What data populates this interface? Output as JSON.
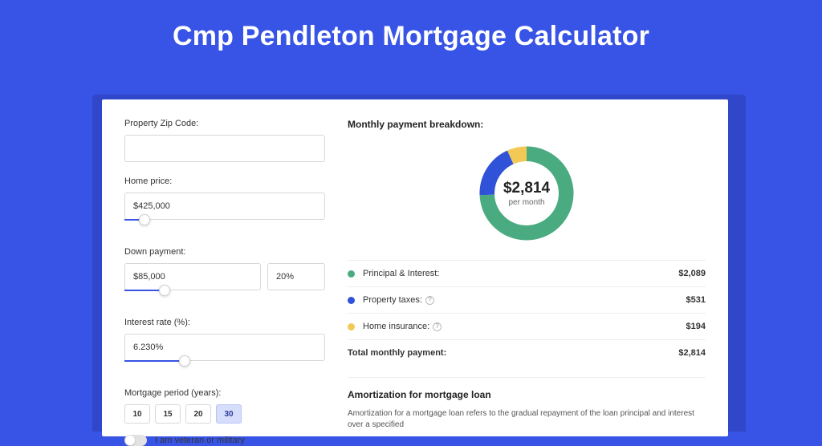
{
  "title": "Cmp Pendleton Mortgage Calculator",
  "form": {
    "zip": {
      "label": "Property Zip Code:",
      "value": ""
    },
    "homePrice": {
      "label": "Home price:",
      "value": "$425,000",
      "sliderPct": 10
    },
    "downPayment": {
      "label": "Down payment:",
      "value": "$85,000",
      "pct": "20%",
      "sliderPct": 20
    },
    "interestRate": {
      "label": "Interest rate (%):",
      "value": "6.230%",
      "sliderPct": 30
    },
    "period": {
      "label": "Mortgage period (years):",
      "options": [
        "10",
        "15",
        "20",
        "30"
      ],
      "active": "30"
    },
    "veteran": {
      "label": "I am veteran or military",
      "on": false
    }
  },
  "breakdown": {
    "heading": "Monthly payment breakdown:",
    "centerAmount": "$2,814",
    "centerSub": "per month",
    "items": [
      {
        "label": "Principal & Interest:",
        "value": "$2,089",
        "color": "#4bab80",
        "hasInfo": false
      },
      {
        "label": "Property taxes:",
        "value": "$531",
        "color": "#2f52d9",
        "hasInfo": true
      },
      {
        "label": "Home insurance:",
        "value": "$194",
        "color": "#f2c955",
        "hasInfo": true
      }
    ],
    "totalLabel": "Total monthly payment:",
    "totalValue": "$2,814"
  },
  "amortization": {
    "title": "Amortization for mortgage loan",
    "text": "Amortization for a mortgage loan refers to the gradual repayment of the loan principal and interest over a specified"
  },
  "chart_data": {
    "type": "pie",
    "title": "Monthly payment breakdown",
    "series": [
      {
        "name": "Principal & Interest",
        "value": 2089,
        "color": "#4bab80"
      },
      {
        "name": "Property taxes",
        "value": 531,
        "color": "#2f52d9"
      },
      {
        "name": "Home insurance",
        "value": 194,
        "color": "#f2c955"
      }
    ],
    "total": 2814,
    "unit": "USD/month"
  }
}
